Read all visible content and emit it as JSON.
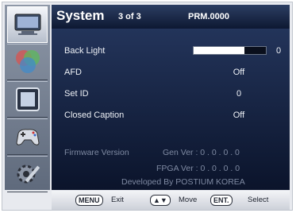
{
  "header": {
    "title": "System",
    "page": "3 of 3",
    "model": "PRM.0000"
  },
  "sidebar": {
    "icons": [
      "monitor-icon",
      "color-circles-icon",
      "display-frame-icon",
      "gamepad-icon",
      "gear-tools-icon"
    ]
  },
  "menu": {
    "items": [
      {
        "label": "Back Light",
        "value": "0",
        "level": 0.7
      },
      {
        "label": "AFD",
        "value": "Off"
      },
      {
        "label": "Set ID",
        "value": "0"
      },
      {
        "label": "Closed Caption",
        "value": "Off"
      }
    ]
  },
  "info": {
    "firmware_label": "Firmware Version",
    "gen_ver": "Gen Ver  :  0 . 0 . 0 . 0",
    "fpga_ver": "FPGA Ver  :  0 . 0 . 0 . 0",
    "developer": "Developed By POSTIUM KOREA"
  },
  "footer": {
    "menu_key": "MENU",
    "menu_text": "Exit",
    "move_key": "▲▼",
    "move_text": "Move",
    "enter_key": "ENT.",
    "enter_text": "Select"
  },
  "colors": {
    "header": "#12203f",
    "panel": "#1b2a4b",
    "bar_fill": "#ffffff"
  }
}
